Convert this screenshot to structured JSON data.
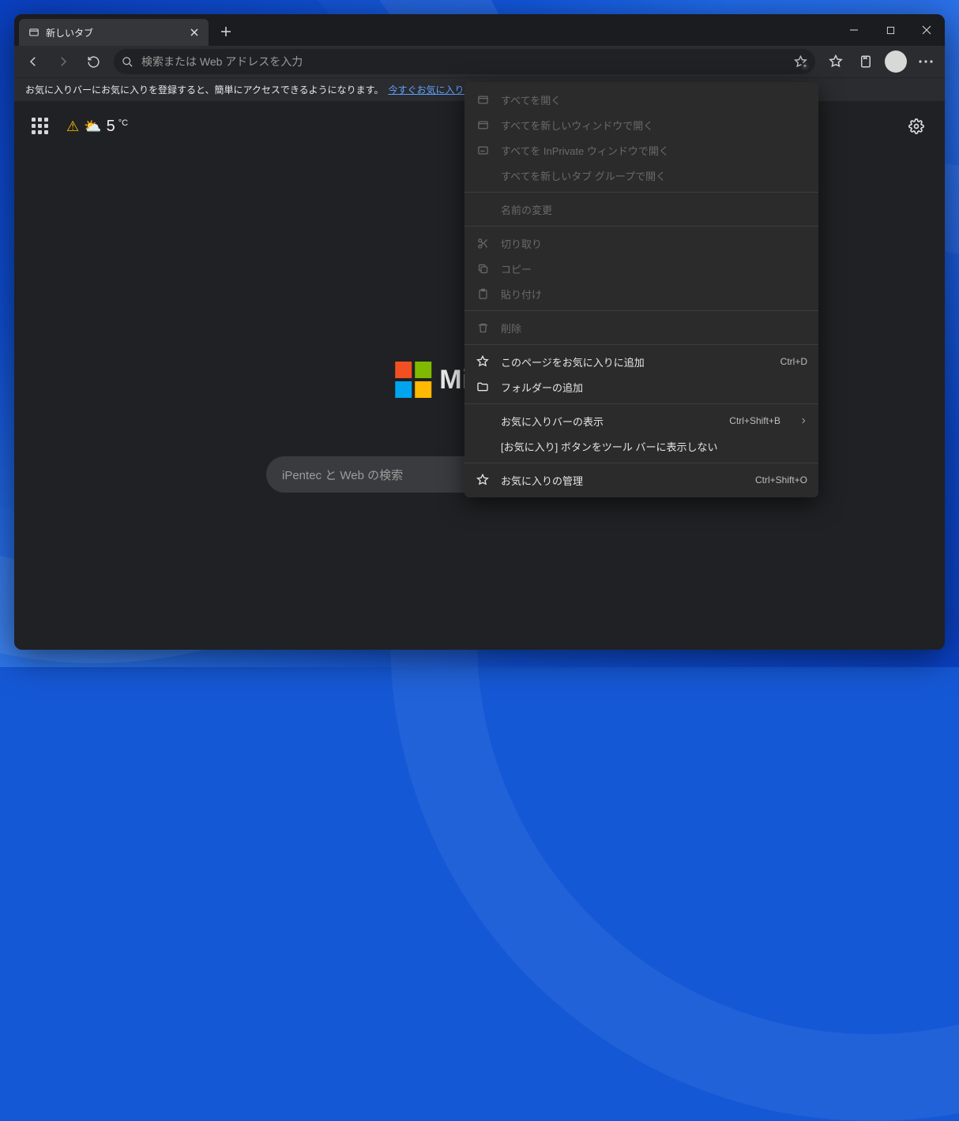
{
  "tab": {
    "title": "新しいタブ"
  },
  "toolbar": {
    "search_placeholder": "検索または Web アドレスを入力"
  },
  "favbar": {
    "text": "お気に入りバーにお気に入りを登録すると、簡単にアクセスできるようになります。",
    "link": "今すぐお気に入りを管理する"
  },
  "weather": {
    "temp": "5",
    "unit": "°C"
  },
  "logo_text": "Microsoft",
  "ntp_search_placeholder": "iPentec と Web の検索",
  "context_menu": {
    "open_all": "すべてを開く",
    "open_all_new_window": "すべてを新しいウィンドウで開く",
    "open_all_inprivate": "すべてを InPrivate ウィンドウで開く",
    "open_all_tab_group": "すべてを新しいタブ グループで開く",
    "rename": "名前の変更",
    "cut": "切り取り",
    "copy": "コピー",
    "paste": "貼り付け",
    "delete": "削除",
    "add_page": "このページをお気に入りに追加",
    "add_page_shortcut": "Ctrl+D",
    "add_folder": "フォルダーの追加",
    "show_fav_bar": "お気に入りバーの表示",
    "show_fav_bar_shortcut": "Ctrl+Shift+B",
    "hide_fav_button": "[お気に入り] ボタンをツール バーに表示しない",
    "manage_fav": "お気に入りの管理",
    "manage_fav_shortcut": "Ctrl+Shift+O"
  }
}
